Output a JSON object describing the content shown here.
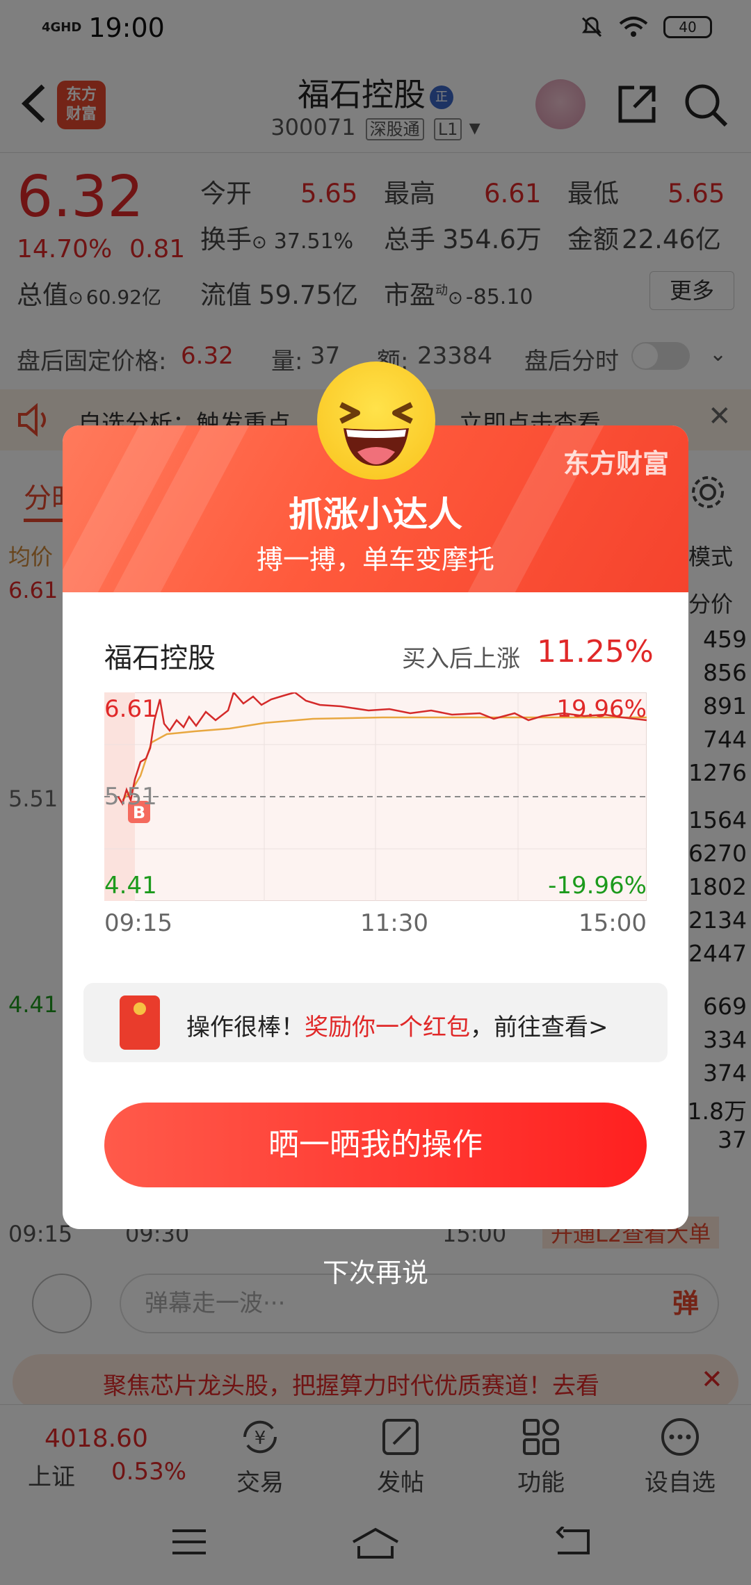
{
  "status_bar": {
    "network": "4GHD",
    "time": "19:00",
    "battery": "40"
  },
  "header": {
    "stock_name": "福石控股",
    "badge": "正",
    "stock_code": "300071",
    "tag_connect": "深股通",
    "tag_level": "L1"
  },
  "quote": {
    "price": "6.32",
    "change_pct": "14.70%",
    "change": "0.81",
    "open_label": "今开",
    "open": "5.65",
    "high_label": "最高",
    "high": "6.61",
    "low_label": "最低",
    "low": "5.65",
    "turnover_label": "换手",
    "turnover": "37.51%",
    "volume_label": "总手",
    "volume": "354.6万",
    "amount_label": "金额",
    "amount": "22.46亿",
    "mktcap_label": "总值",
    "mktcap": "60.92亿",
    "float_label": "流值",
    "float": "59.75亿",
    "pe_label": "市盈",
    "pe_sup": "动",
    "pe": "-85.10",
    "more_label": "更多"
  },
  "afterhours": {
    "price_label": "盘后固定价格:",
    "price": "6.32",
    "vol_label": "量:",
    "vol": "37",
    "amt_label": "额:",
    "amt": "23384",
    "timeshare_label": "盘后分时"
  },
  "notice": {
    "text": "自选分析：触发重点",
    "link": "立即点击查看"
  },
  "tabs": {
    "active": "分时"
  },
  "bg_chart": {
    "avg_label": "均价",
    "mode_label": "模式",
    "price_col": "分价",
    "high": "6.61",
    "mid": "5.51",
    "low": "4.41",
    "t1": "09:15",
    "t2": "09:30",
    "t3": "15:00",
    "l2_banner": "开通L2查看大单"
  },
  "order_book": [
    "459",
    "856",
    "891",
    "744",
    "1276",
    "1564",
    "6270",
    "1802",
    "2134",
    "2447"
  ],
  "trades": [
    "669",
    "334",
    "374",
    "1.8万",
    "37"
  ],
  "comment": {
    "placeholder": "弹幕走一波···",
    "dan": "弹"
  },
  "ad": {
    "text": "聚焦芯片龙头股，把握算力时代优质赛道！去看"
  },
  "bottom_nav": {
    "index_value": "4018.60",
    "index_name": "上证",
    "index_pct": "0.53%",
    "items": [
      {
        "label": "交易",
        "icon": "yen-swap-icon"
      },
      {
        "label": "发帖",
        "icon": "edit-post-icon"
      },
      {
        "label": "功能",
        "icon": "grid-apps-icon"
      },
      {
        "label": "设自选",
        "icon": "more-circle-icon"
      }
    ]
  },
  "modal": {
    "brand": "东方财富",
    "title": "抓涨小达人",
    "subtitle": "搏一搏，单车变摩托",
    "stock": "福石控股",
    "rise_label": "买入后上涨",
    "rise_value": "11.25%",
    "chart": {
      "y_high": "6.61",
      "y_mid": "5.51",
      "y_low": "4.41",
      "pct_high": "19.96%",
      "pct_low": "-19.96%",
      "x_start": "09:15",
      "x_mid": "11:30",
      "x_end": "15:00",
      "buy_marker": "B"
    },
    "reward_prefix": "操作很棒！",
    "reward_highlight": "奖励你一个红包",
    "reward_suffix": "，前往查看>",
    "share_button": "晒一晒我的操作",
    "dismiss": "下次再说"
  },
  "colors": {
    "up": "#e02828",
    "down": "#1c9a1c",
    "brand": "#e8492f"
  }
}
